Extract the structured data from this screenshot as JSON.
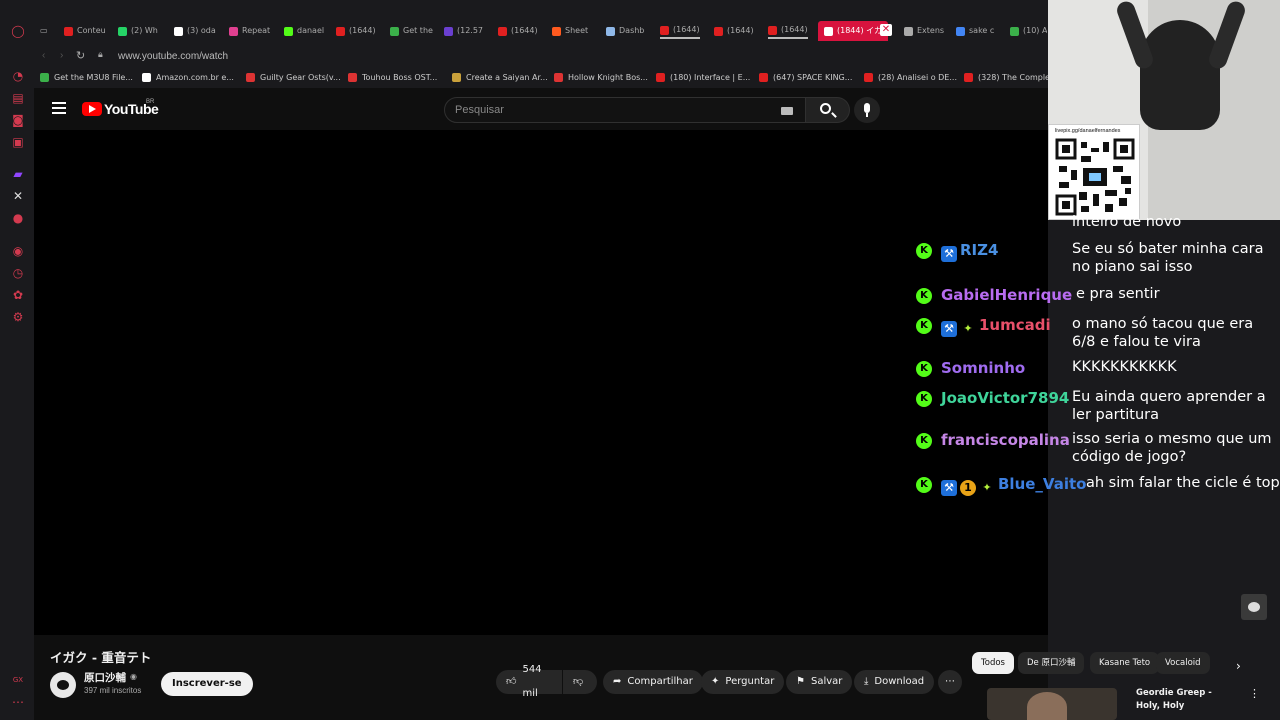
{
  "browser": {
    "tabs": [
      {
        "label": "Conteu",
        "color": "#e02020"
      },
      {
        "label": "(2) Wh",
        "color": "#25d366"
      },
      {
        "label": "(3) oda",
        "color": "#ffffff"
      },
      {
        "label": "Repeat",
        "color": "#e04090"
      },
      {
        "label": "danael",
        "color": "#53fc18"
      },
      {
        "label": "(1644)",
        "color": "#e02020"
      },
      {
        "label": "Get the",
        "color": "#3bb04a"
      },
      {
        "label": "(12.57",
        "color": "#6a3fd0"
      },
      {
        "label": "(1644)",
        "color": "#e02020"
      },
      {
        "label": "Sheet",
        "color": "#ff5a1f"
      },
      {
        "label": "Dashb",
        "color": "#8fb8e8"
      },
      {
        "label": "(1644)",
        "color": "#e02020"
      },
      {
        "label": "(1644)",
        "color": "#e02020"
      },
      {
        "label": "(1644)",
        "color": "#e02020"
      },
      {
        "label": "(1844) イガ",
        "color": "#ffffff"
      },
      {
        "label": "Extens",
        "color": "#aaaaaa"
      },
      {
        "label": "sake c",
        "color": "#4285f4"
      },
      {
        "label": "(10) A",
        "color": "#3bb04a"
      }
    ],
    "url": "www.youtube.com/watch",
    "bookmarks": [
      {
        "label": "Get the M3U8 File...",
        "color": "#3bb04a"
      },
      {
        "label": "Amazon.com.br e...",
        "color": "#ffffff"
      },
      {
        "label": "Guilty Gear Osts(v...",
        "color": "#d33"
      },
      {
        "label": "Touhou Boss OST...",
        "color": "#d33"
      },
      {
        "label": "Create a Saiyan Ar...",
        "color": "#c9a13b"
      },
      {
        "label": "Hollow Knight Bos...",
        "color": "#d33"
      },
      {
        "label": "(180) Interface | E...",
        "color": "#e02020"
      },
      {
        "label": "(647) SPACE KING...",
        "color": "#e02020"
      },
      {
        "label": "(28) Analisei o DE...",
        "color": "#e02020"
      },
      {
        "label": "(328) The Comple",
        "color": "#e02020"
      }
    ]
  },
  "youtube": {
    "logo_text": "YouTube",
    "region": "BR",
    "search_placeholder": "Pesquisar",
    "video_title": "イガク - 重音テト",
    "channel_name": "原口沙輔",
    "subscribers": "397 mil inscritos",
    "subscribe_label": "Inscrever-se",
    "likes": "544 mil",
    "share_label": "Compartilhar",
    "ask_label": "Perguntar",
    "save_label": "Salvar",
    "download_label": "Download",
    "chips": [
      "Todos",
      "De 原口沙輔",
      "Kasane Teto",
      "Vocaloid"
    ],
    "related_title": "Geordie Greep - Holy, Holy"
  },
  "overlay": {
    "qr_caption": "livepix.gg/danaelfernandes",
    "chat_top_fragment": "inteiro de novo",
    "chat": [
      {
        "user": "RIZ4",
        "color": "#4a90e2",
        "badges": [
          "⚒"
        ],
        "message": "Se eu só bater minha cara no piano sai isso"
      },
      {
        "user": "GabielHenrique",
        "color": "#b86cf0",
        "badges": [],
        "message": "e pra sentir"
      },
      {
        "user": "1umcadi",
        "color": "#e8506a",
        "badges": [
          "⚒",
          "✦"
        ],
        "message": "o mano só tacou que era 6/8 e falou te vira"
      },
      {
        "user": "Somninho",
        "color": "#a06cf0",
        "badges": [],
        "message": "KKKKKKKKKKK"
      },
      {
        "user": "JoaoVictor7894",
        "color": "#3fd49a",
        "badges": [],
        "message": "Eu ainda quero aprender a ler partitura"
      },
      {
        "user": "franciscopalina",
        "color": "#c586e6",
        "badges": [],
        "message": "isso seria o mesmo que um código de jogo?"
      },
      {
        "user": "Blue_Vaito",
        "color": "#3d7fe0",
        "badges": [
          "⚒",
          "1",
          "✦"
        ],
        "message": "ah sim falar the cicle é top"
      }
    ]
  }
}
